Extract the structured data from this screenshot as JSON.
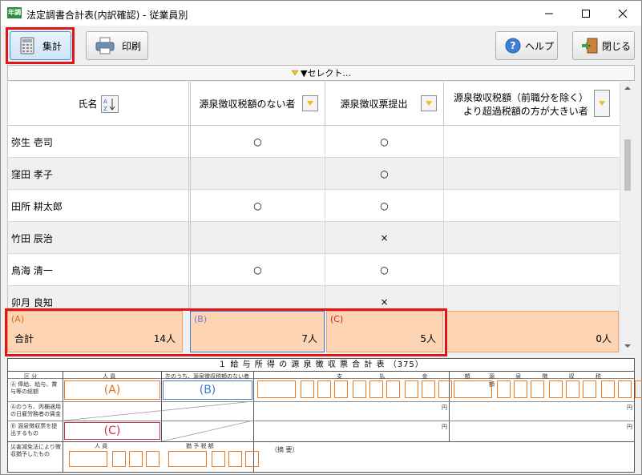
{
  "window": {
    "title": "法定調書合計表(内訳確認) - 従業員別",
    "app_icon": "年調"
  },
  "toolbar": {
    "aggregate": "集計",
    "print": "印刷",
    "help": "ヘルプ",
    "close": "閉じる"
  },
  "select_label": "▼セレクト...",
  "columns": {
    "name": "氏名",
    "no_withholding": "源泉徴収税額のない者",
    "submitted": "源泉徴収票提出",
    "excess": "源泉徴収税額（前職分を除く）",
    "excess2": "より超過税額の方が大きい者"
  },
  "rows": [
    {
      "name": "弥生 壱司",
      "no_withholding": "○",
      "submitted": "○",
      "excess": ""
    },
    {
      "name": "窪田 孝子",
      "no_withholding": "",
      "submitted": "○",
      "excess": ""
    },
    {
      "name": "田所 耕太郎",
      "no_withholding": "○",
      "submitted": "○",
      "excess": ""
    },
    {
      "name": "竹田 辰治",
      "no_withholding": "",
      "submitted": "×",
      "excess": ""
    },
    {
      "name": "鳥海 清一",
      "no_withholding": "○",
      "submitted": "○",
      "excess": ""
    },
    {
      "name": "卯月 良知",
      "no_withholding": "",
      "submitted": "×",
      "excess": ""
    }
  ],
  "summary": {
    "a_label": "(A)",
    "total_label": "合計",
    "a_value": "14人",
    "b_label": "(B)",
    "b_value": "7人",
    "c_label": "(C)",
    "c_value": "5人",
    "d_value": "0人"
  },
  "form": {
    "title": "１ 給 与 所 得 の 源 泉 徴 収 票 合 計 表 （375）",
    "a": "(A)",
    "b": "(B)",
    "c": "(C)",
    "kubun": "区 分",
    "ninin": "人 員",
    "nouchi": "左のうち、源泉徴収税額のない者",
    "shiharai": "支 払 金 額",
    "gensen": "源 泉 徴 収 税 額",
    "row1": "Ⓐ 俸給、給与、賞与等の総額",
    "row2": "Ⓐのうち、丙欄適用の日雇労務者の賃金",
    "row3": "Ⓑ 源泉徴収票を提出するもの",
    "row4": "災害減免法により徴収猶予したもの",
    "tekiyo": "（摘 要）",
    "en": "円",
    "jinin": "人 員",
    "yuyo": "猶 予 税 額"
  }
}
